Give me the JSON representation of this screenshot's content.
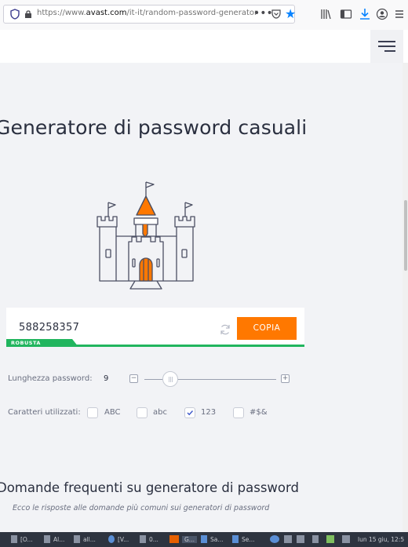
{
  "browser": {
    "url_prefix": "https://www.",
    "url_domain": "avast.com",
    "url_path": "/it-it/random-password-generator",
    "dots": "•••",
    "star": "★"
  },
  "page": {
    "title": "Generatore di password casuali",
    "password": {
      "value": "588258357",
      "strength": "ROBUSTA",
      "copy_label": "COPIA"
    },
    "length": {
      "label": "Lunghezza password:",
      "value": "9",
      "minus": "−",
      "plus": "+"
    },
    "chars": {
      "label": "Caratteri utilizzati:",
      "options": [
        {
          "label": "ABC",
          "checked": false
        },
        {
          "label": "abc",
          "checked": false
        },
        {
          "label": "123",
          "checked": true
        },
        {
          "label": "#$&",
          "checked": false
        }
      ]
    },
    "faq": {
      "title": "Domande frequenti su generatore di password",
      "subtitle": "Ecco le risposte alle domande più comuni sui generatori di password"
    }
  },
  "taskbar": {
    "items": [
      "[O...",
      "Al...",
      "all...",
      "[V...",
      "0...",
      "G...",
      "Sa...",
      "Se..."
    ],
    "clock": "lun 15 giu, 12:5"
  },
  "colors": {
    "accent": "#ff7800",
    "strength": "#21b55e",
    "firefox_blue": "#0a84ff"
  }
}
